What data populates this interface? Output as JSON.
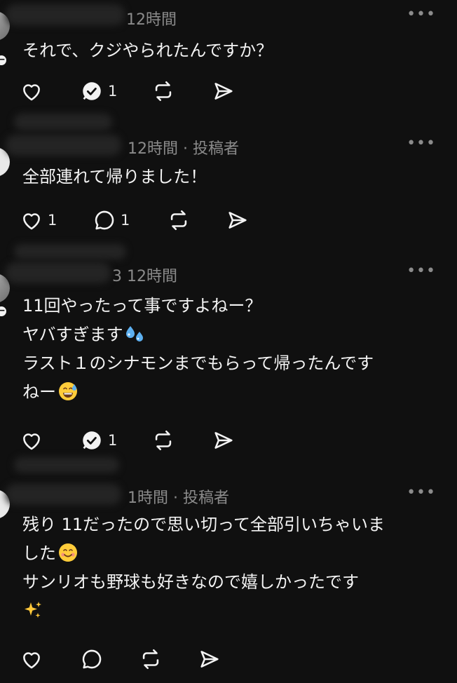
{
  "posts": [
    {
      "time": "12時間",
      "author_tag": "",
      "lines": [
        "それで、クジやられたんですか？"
      ],
      "actions": {
        "likes": "",
        "replies": "1",
        "reply_checked": true
      },
      "more": "•••"
    },
    {
      "time": "12時間 · 投稿者",
      "lines": [
        "全部連れて帰りました！"
      ],
      "actions": {
        "likes": "1",
        "replies": "1",
        "reply_checked": false
      },
      "more": "•••"
    },
    {
      "time": "3 12時間",
      "lines": [
        "11回やったって事ですよねー？",
        "ヤバすぎます",
        "ラスト１のシナモンまでもらって帰ったんです",
        "ねー"
      ],
      "actions": {
        "likes": "",
        "replies": "1",
        "reply_checked": true
      },
      "more": "•••"
    },
    {
      "time": "1時間 · 投稿者",
      "lines": [
        "残り 11だったので思い切って全部引いちゃいま",
        "した",
        "サンリオも野球も好きなので嬉しかったです",
        ""
      ],
      "actions": {
        "likes": "",
        "replies": "",
        "reply_checked": false
      },
      "more": "•••"
    }
  ],
  "icons": {
    "like": "heart-icon",
    "reply": "speech-bubble-icon",
    "reply_checked": "reply-check-icon",
    "repost": "repost-icon",
    "share": "send-icon",
    "sweat_drops": "sweat-droplets-emoji-icon",
    "grin_sweat": "grinning-sweat-emoji-icon",
    "smile": "smiling-face-emoji-icon",
    "sparkles": "sparkles-emoji-icon"
  },
  "colors": {
    "background": "#101010",
    "text": "#f3f3f3",
    "meta": "#8b8b8b"
  }
}
